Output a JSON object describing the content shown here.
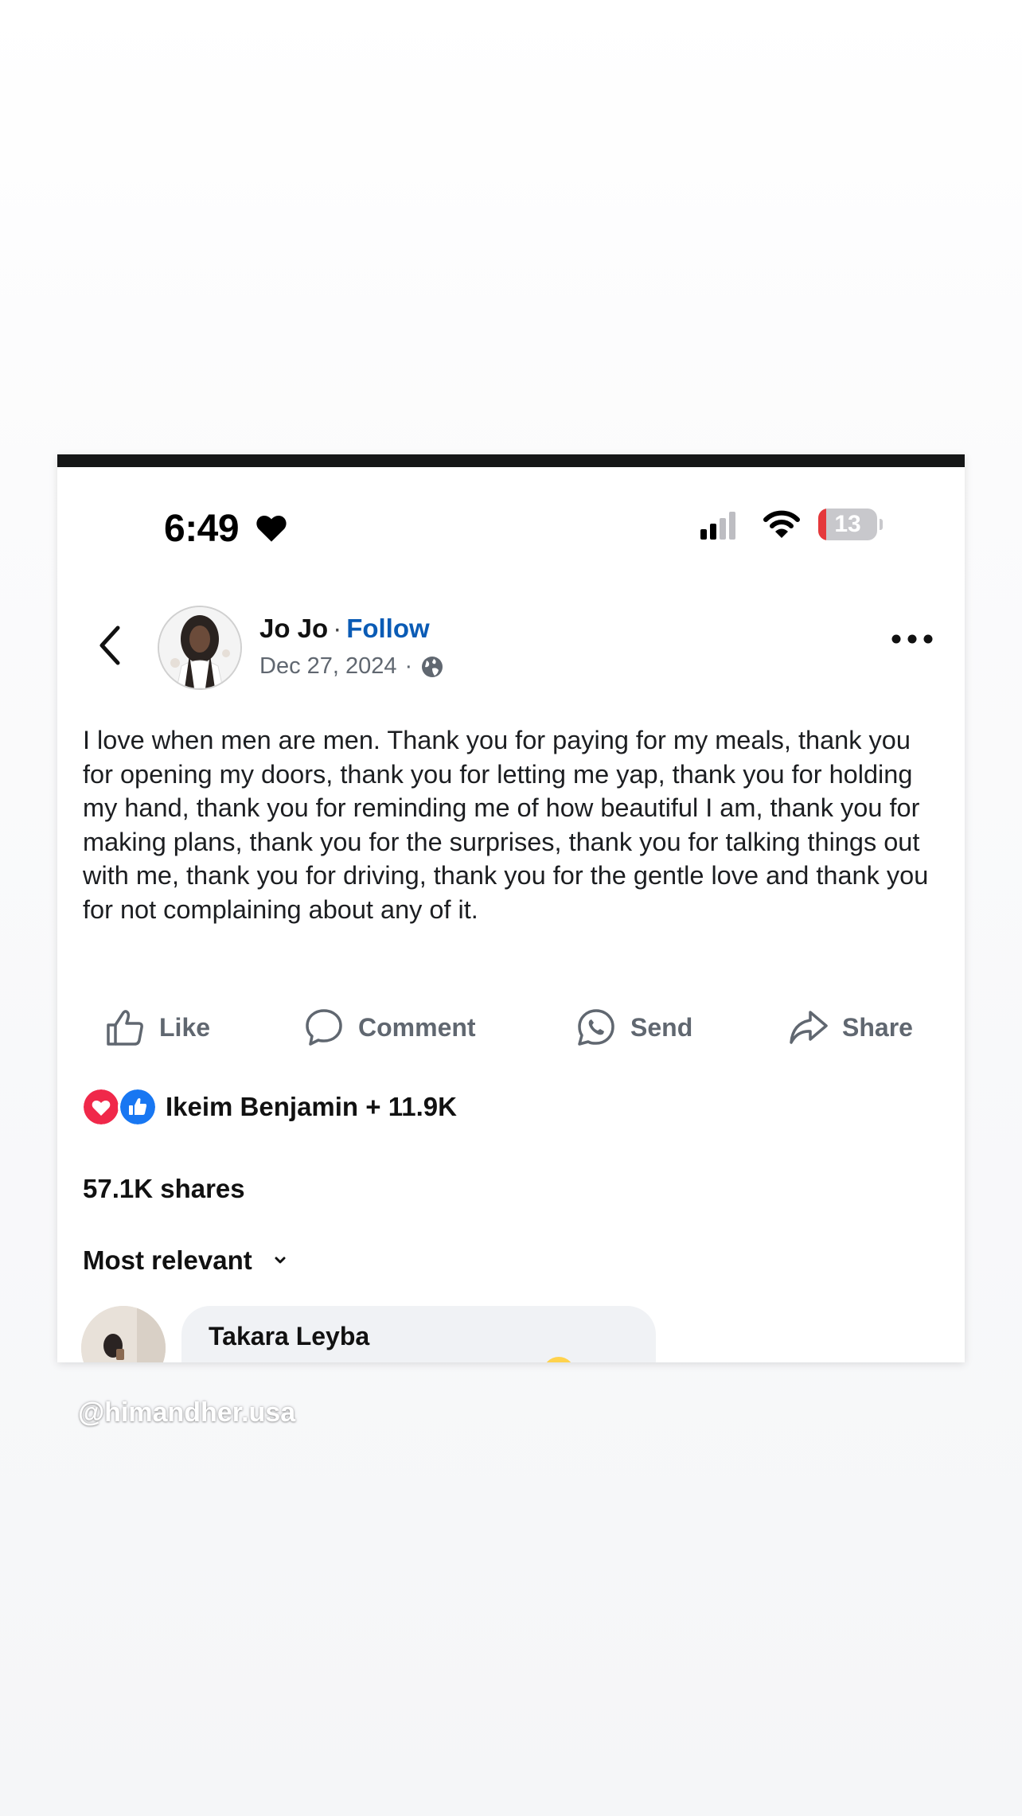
{
  "status_bar": {
    "time": "6:49",
    "battery_level": "13",
    "battery_fraction": 0.13,
    "icons": [
      "heart-icon",
      "cellular-signal-icon",
      "wifi-icon",
      "battery-icon"
    ]
  },
  "post": {
    "author": "Jo Jo",
    "separator": "·",
    "follow_label": "Follow",
    "date": "Dec 27, 2024",
    "date_separator": "·",
    "audience_icon": "globe-icon",
    "text": "I love when men are men. Thank you for paying for my meals, thank you for opening my doors, thank you for letting me yap, thank you for holding my hand, thank you for reminding me of how beautiful I am, thank you for making plans, thank you for the surprises, thank you for talking things out with me, thank you for driving, thank you for the gentle love and thank you for not complaining about any of it."
  },
  "actions": {
    "like_label": "Like",
    "comment_label": "Comment",
    "send_label": "Send",
    "share_label": "Share"
  },
  "reactions": {
    "summary": "Ikeim Benjamin + 11.9K",
    "types": [
      "love",
      "like"
    ]
  },
  "shares": "57.1K shares",
  "comments": {
    "sort_label": "Most relevant",
    "items": [
      {
        "author": "Takara Leyba"
      }
    ]
  },
  "watermark": "@himandher.usa",
  "colors": {
    "follow": "#0a5bb5",
    "love": "#f0284a",
    "like": "#1877f2",
    "battery_low": "#e5383b"
  }
}
